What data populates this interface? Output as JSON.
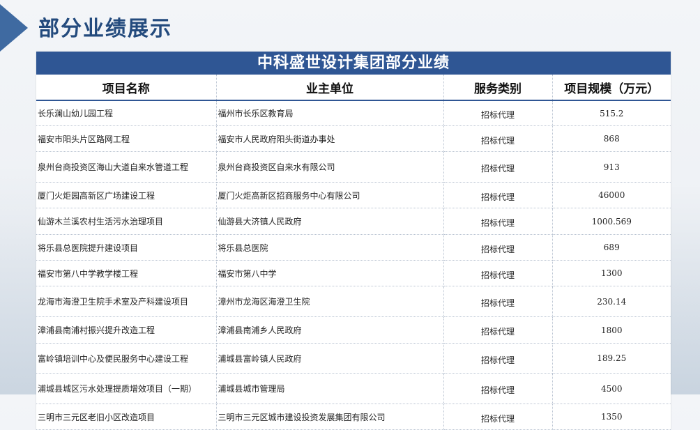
{
  "slide": {
    "title": "部分业绩展示",
    "accent_color": "#3f6aa1",
    "title_color": "#234a7d"
  },
  "table": {
    "title": "中科盛世设计集团部分业绩",
    "header_color": "#2f5694",
    "columns": [
      "项目名称",
      "业主单位",
      "服务类别",
      "项目规模（万元）"
    ],
    "rows": [
      [
        "长乐澜山幼儿园工程",
        "福州市长乐区教育局",
        "招标代理",
        "515.2"
      ],
      [
        "福安市阳头片区路网工程",
        "福安市人民政府阳头街道办事处",
        "招标代理",
        "868"
      ],
      [
        "泉州台商投资区海山大道自来水管道工程",
        "泉州台商投资区自来水有限公司",
        "招标代理",
        "913"
      ],
      [
        "厦门火炬园高新区广场建设工程",
        "厦门火炬高新区招商服务中心有限公司",
        "招标代理",
        "46000"
      ],
      [
        "仙游木兰溪农村生活污水治理项目",
        "仙游县大济镇人民政府",
        "招标代理",
        "1000.569"
      ],
      [
        "将乐县总医院提升建设项目",
        "将乐县总医院",
        "招标代理",
        "689"
      ],
      [
        "福安市第八中学教学楼工程",
        "福安市第八中学",
        "招标代理",
        "1300"
      ],
      [
        "龙海市海澄卫生院手术室及产科建设项目",
        "漳州市龙海区海澄卫生院",
        "招标代理",
        "230.14"
      ],
      [
        "漳浦县南浦村振兴提升改造工程",
        "漳浦县南浦乡人民政府",
        "招标代理",
        "1800"
      ],
      [
        "富岭镇培训中心及便民服务中心建设工程",
        "浦城县富岭镇人民政府",
        "招标代理",
        "189.25"
      ],
      [
        "浦城县城区污水处理提质增效项目（一期）",
        "浦城县城市管理局",
        "招标代理",
        "4500"
      ],
      [
        "三明市三元区老旧小区改造项目",
        "三明市三元区城市建设投资发展集团有限公司",
        "招标代理",
        "1350"
      ]
    ]
  }
}
